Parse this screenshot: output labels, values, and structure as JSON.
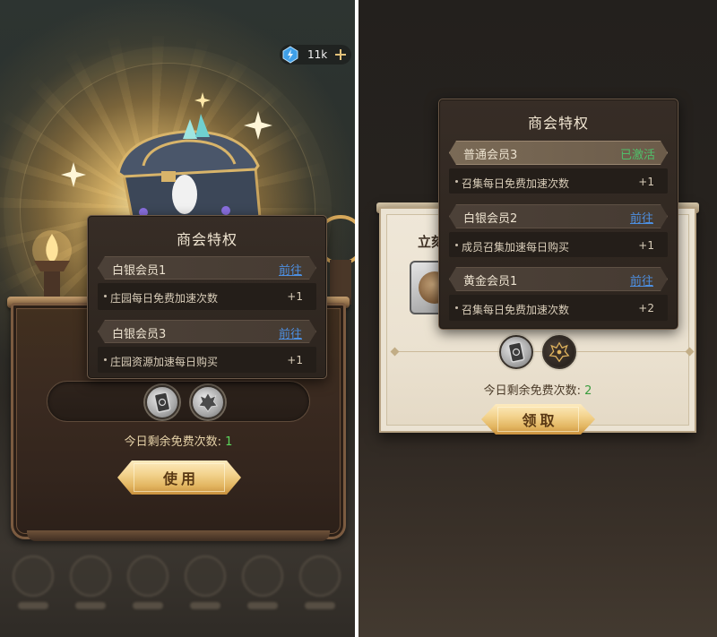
{
  "left_screen": {
    "currency": {
      "amount": "11k",
      "icon": "crystal-icon",
      "add_icon": "plus-icon"
    },
    "popup": {
      "title": "商会特权",
      "tiers": [
        {
          "name": "白银会员1",
          "action": "前往",
          "benefit": "庄园每日免费加速次数",
          "bonus": "+1"
        },
        {
          "name": "白银会员3",
          "action": "前往",
          "benefit": "庄园资源加速每日购买",
          "bonus": "+1"
        }
      ]
    },
    "reward_icons": [
      "card-icon",
      "crest-icon"
    ],
    "remaining": {
      "label": "今日剩余免费次数: ",
      "count": "1"
    },
    "button_label": "使用"
  },
  "right_screen": {
    "background_title": "立刻",
    "popup": {
      "title": "商会特权",
      "tiers": [
        {
          "name": "普通会员3",
          "status": "已激活",
          "active": true,
          "benefit": "召集每日免费加速次数",
          "bonus": "+1"
        },
        {
          "name": "白银会员2",
          "action": "前往",
          "benefit": "成员召集加速每日购买",
          "bonus": "+1"
        },
        {
          "name": "黄金会员1",
          "action": "前往",
          "benefit": "召集每日免费加速次数",
          "bonus": "+2"
        }
      ]
    },
    "reward_icons": [
      "card-icon",
      "crest-icon"
    ],
    "remaining": {
      "label": "今日剩余免费次数: ",
      "count": "2"
    },
    "button_label": "领取"
  },
  "colors": {
    "link": "#4d8fe0",
    "active_status": "#4fc06a",
    "count_on_dark": "#5cd65c",
    "count_on_light": "#3a9c3e",
    "button_gold": "#eac57a"
  }
}
